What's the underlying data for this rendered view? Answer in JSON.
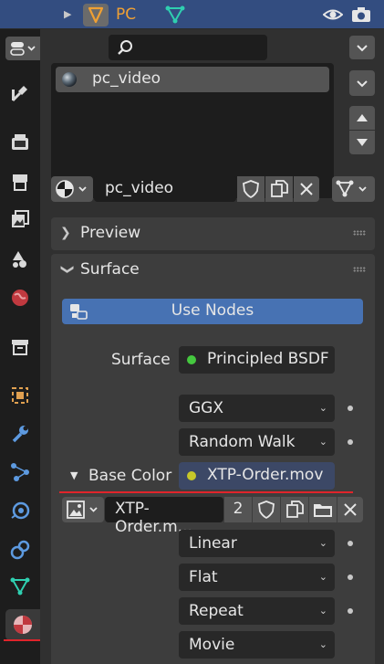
{
  "header": {
    "object_name": "PC"
  },
  "material_slots": {
    "items": [
      {
        "name": "pc_video"
      }
    ]
  },
  "material_selector": {
    "name": "pc_video"
  },
  "panels": {
    "preview": {
      "label": "Preview"
    },
    "surface": {
      "label": "Surface",
      "use_nodes_label": "Use Nodes",
      "surface_label": "Surface",
      "surface_value": "Principled BSDF",
      "distribution": "GGX",
      "subsurface_method": "Random Walk",
      "base_color_label": "Base Color",
      "base_color_value": "XTP-Order.mov",
      "image_name": "XTP-Order.m...",
      "image_users": "2",
      "interpolation": "Linear",
      "projection": "Flat",
      "extension": "Repeat",
      "source": "Movie"
    }
  },
  "colors": {
    "accent": "#4772b3",
    "header": "#334d80",
    "orange": "#f0a033",
    "green": "#45c83f",
    "yellow": "#c7c729",
    "red_marker": "#e0242b"
  },
  "icons": [
    "eye-icon",
    "camera-icon",
    "properties-mode-icon",
    "search-icon",
    "tool-icon",
    "render-icon",
    "output-icon",
    "view-layer-icon",
    "scene-icon",
    "world-icon",
    "collection-icon",
    "object-icon",
    "modifier-icon",
    "particles-icon",
    "physics-icon",
    "constraints-icon",
    "data-icon",
    "material-icon"
  ]
}
